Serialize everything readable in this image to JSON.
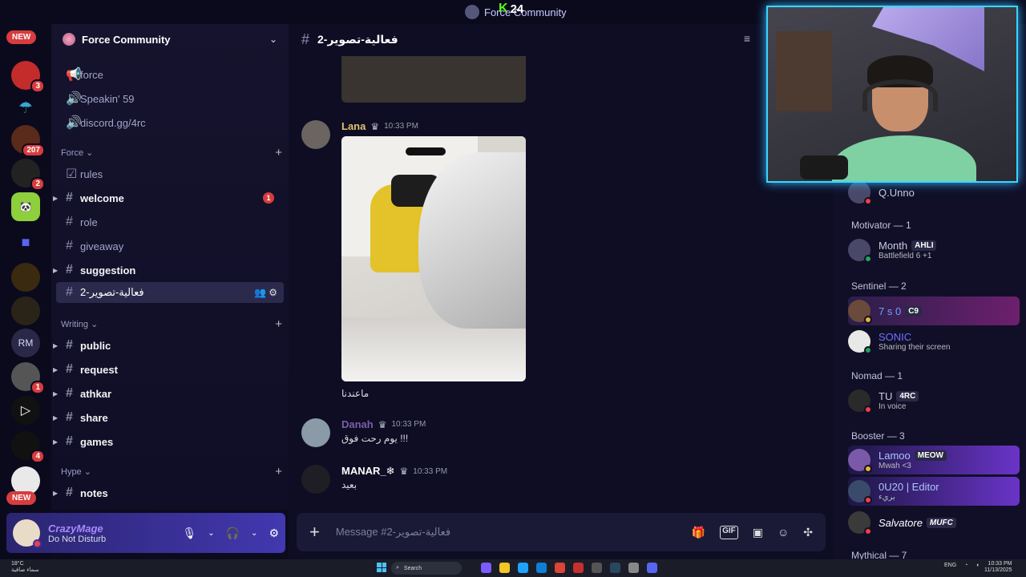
{
  "window": {
    "title": "Force Community"
  },
  "overlay": {
    "kick_viewers": "24"
  },
  "rail": {
    "new_label_top": "NEW",
    "new_label_bottom": "NEW",
    "badges": [
      "3",
      "207",
      "2",
      "1",
      "4"
    ],
    "rm_label": "RM"
  },
  "server": {
    "name": "Force Community"
  },
  "channels": {
    "top": [
      "force",
      "Speakin' 59",
      "discord.gg/4rc"
    ],
    "force_category": "Force",
    "force_items": [
      "rules",
      "welcome",
      "role",
      "giveaway",
      "suggestion",
      "2-فعالية-تصوير"
    ],
    "welcome_unread": "1",
    "writing_category": "Writing",
    "writing_items": [
      "public",
      "request",
      "athkar",
      "share",
      "games"
    ],
    "hype_category": "Hype",
    "hype_items": [
      "notes"
    ]
  },
  "user": {
    "name": "CrazyMage",
    "status": "Do Not Disturb"
  },
  "chat": {
    "channel_name": "2-فعالية-تصوير",
    "messages": [
      {
        "author": "Lana",
        "time": "10:33 PM",
        "text": "ماعندنا",
        "color": "#e0c36a"
      },
      {
        "author": "Danah",
        "time": "10:33 PM",
        "text": "يوم رحت فوق !!!",
        "color": "#7a5fa8"
      },
      {
        "author": "MANAR_❄",
        "time": "10:33 PM",
        "text": "بعيد",
        "color": "#ffffff"
      }
    ],
    "composer_placeholder": "Message #2-فعالية-تصوير"
  },
  "members": {
    "partial": {
      "name": "Q.Unno"
    },
    "groups": [
      {
        "label": "Motivator — 1"
      },
      {
        "label": "Sentinel — 2"
      },
      {
        "label": "Nomad — 1"
      },
      {
        "label": "Booster — 3"
      },
      {
        "label": "Mythical — 7"
      }
    ],
    "list": [
      {
        "name": "Month",
        "tag": "AHLI",
        "activity": "Battlefield 6 +1",
        "color": "#c9cbe0"
      },
      {
        "name": "7 s 0",
        "tag": "C9",
        "activity": "",
        "color": "#6aa3ff"
      },
      {
        "name": "SONIC",
        "tag": "",
        "activity": "Sharing their screen",
        "color": "#6f6fff"
      },
      {
        "name": "TU",
        "tag": "4RC",
        "activity": "In voice",
        "color": "#c9cbe0"
      },
      {
        "name": "Lamoo",
        "tag": "MEOW",
        "activity": "Mwah <3",
        "color": "#a9c6ff"
      },
      {
        "name": "0U20 | Editor",
        "tag": "",
        "activity": "بريء",
        "color": "#a9c6ff"
      },
      {
        "name": "Salvatore",
        "tag": "MUFC",
        "activity": "",
        "color": "#ffffff"
      }
    ]
  },
  "taskbar": {
    "weather": "18°C",
    "weather_sub": "سماء صافية",
    "search": "Search",
    "lang": "ENG",
    "time": "10:33 PM",
    "date": "11/13/2025"
  },
  "colors": {
    "accent": "#5865f2",
    "dnd": "#f23f43",
    "online": "#23a55a",
    "cam_border": "#3ad6ff"
  }
}
